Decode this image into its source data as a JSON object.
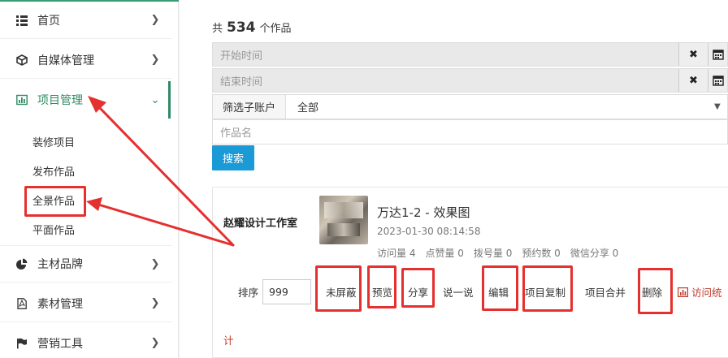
{
  "sidebar": {
    "items": [
      {
        "label": "首页",
        "icon": "grid-icon"
      },
      {
        "label": "自媒体管理",
        "icon": "cube-icon"
      },
      {
        "label": "项目管理",
        "icon": "bar-chart-icon"
      },
      {
        "label": "主材品牌",
        "icon": "pie-chart-icon"
      },
      {
        "label": "素材管理",
        "icon": "pdf-file-icon"
      },
      {
        "label": "营销工具",
        "icon": "flag-icon"
      }
    ],
    "sub_items": [
      "装修项目",
      "发布作品",
      "全景作品",
      "平面作品"
    ]
  },
  "summary": {
    "prefix": "共",
    "count": "534",
    "suffix": "个作品"
  },
  "filters": {
    "start_placeholder": "开始时间",
    "end_placeholder": "结束时间",
    "account_label": "筛选子账户",
    "account_value": "全部",
    "name_placeholder": "作品名",
    "search_label": "搜索"
  },
  "work": {
    "studio": "赵耀设计工作室",
    "title": "万达1-2 - 效果图",
    "time": "2023-01-30 08:14:58",
    "stats": [
      "访问量 4",
      "点赞量 0",
      "拨号量 0",
      "预约数 0",
      "微信分享 0"
    ],
    "sort_label": "排序",
    "sort_value": "999",
    "actions": {
      "unblock": "未屏蔽",
      "preview": "预览",
      "share": "分享",
      "say": "说一说",
      "edit": "编辑",
      "copy": "项目复制",
      "merge": "项目合并",
      "delete": "删除",
      "visit_stats_a": "访问统",
      "visit_stats_b": "计"
    }
  },
  "colors": {
    "accent": "#2e8b64",
    "highlight": "#e53030",
    "search_button": "#1a9ad6",
    "link_red": "#c0392b"
  }
}
